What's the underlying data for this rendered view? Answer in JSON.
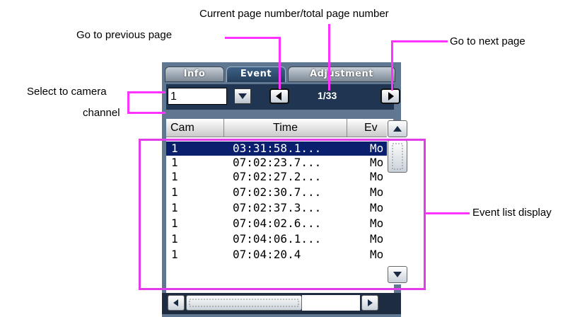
{
  "callouts": {
    "current_page": "Current page number/total page number",
    "prev_page": "Go to previous page",
    "next_page": "Go to next page",
    "select_channel_line1": "Select  to camera",
    "select_channel_line2": "channel",
    "event_list": "Event list display"
  },
  "tabs": [
    {
      "label": "Info"
    },
    {
      "label": "Event"
    },
    {
      "label": "Adjustment"
    }
  ],
  "channel_select": {
    "value": "1"
  },
  "pagination": {
    "indicator": "1/33"
  },
  "columns": [
    "Cam",
    "Time",
    "Ev"
  ],
  "rows": [
    {
      "cam": "1",
      "time": "03:31:58.1...",
      "ev": "Mo"
    },
    {
      "cam": "1",
      "time": "07:02:23.7...",
      "ev": "Mo"
    },
    {
      "cam": "1",
      "time": "07:02:27.2...",
      "ev": "Mo"
    },
    {
      "cam": "1",
      "time": "07:02:30.7...",
      "ev": "Mo"
    },
    {
      "cam": "1",
      "time": "07:02:37.3...",
      "ev": "Mo"
    },
    {
      "cam": "1",
      "time": "07:04:02.6...",
      "ev": "Mo"
    },
    {
      "cam": "1",
      "time": "07:04:06.1...",
      "ev": "Mo"
    },
    {
      "cam": "1",
      "time": "07:04:20.4",
      "ev": "Mo"
    }
  ],
  "colors": {
    "annotation": "#e23ce8",
    "panel": "#5f7790",
    "selection": "#0a1f6e"
  }
}
